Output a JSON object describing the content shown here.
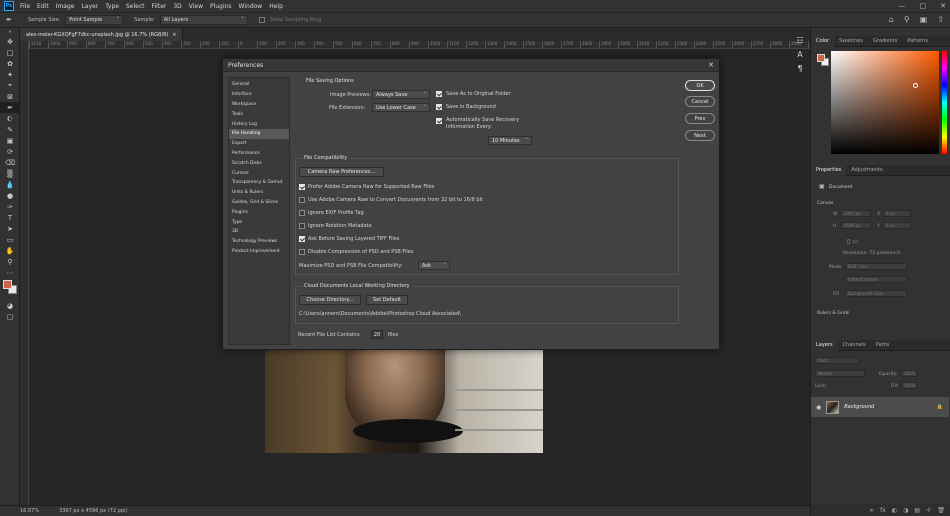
{
  "app": {
    "logo": "Ps",
    "menus": [
      "File",
      "Edit",
      "Image",
      "Layer",
      "Type",
      "Select",
      "Filter",
      "3D",
      "View",
      "Plugins",
      "Window",
      "Help"
    ]
  },
  "options_bar": {
    "sample_size_label": "Sample Size:",
    "sample_size_value": "Point Sample",
    "sample_label": "Sample:",
    "sample_value": "All Layers",
    "sampling_ring_label": "Show Sampling Ring"
  },
  "document": {
    "tab_label": "alex-meier-KGXQFgF7dkc-unsplash.jpg @ 16.7% (RGB/8)",
    "ruler_ticks": [
      "1100",
      "1000",
      "900",
      "800",
      "700",
      "600",
      "500",
      "400",
      "300",
      "200",
      "100",
      "0",
      "100",
      "200",
      "300",
      "400",
      "500",
      "600",
      "700",
      "800",
      "900",
      "1000",
      "1100",
      "1200",
      "1300",
      "1400",
      "1500",
      "1600",
      "1700",
      "1800",
      "1900",
      "2000",
      "2100",
      "2200",
      "2300",
      "2400",
      "2500",
      "2600",
      "2700",
      "2800",
      "2900",
      "3000",
      "3100",
      "3200",
      "3300",
      "3400",
      "3500",
      "3600",
      "3700",
      "3800",
      "3900"
    ]
  },
  "status_bar": {
    "zoom": "16.67%",
    "doc_info": "3367 px x 4596 px (72 ppi)"
  },
  "color_panel": {
    "tabs": [
      "Color",
      "Swatches",
      "Gradients",
      "Patterns"
    ],
    "fg_color": "#c8664a",
    "bg_color": "#f3f3f3"
  },
  "properties_panel": {
    "tabs": [
      "Properties",
      "Adjustments"
    ],
    "doc_label": "Document",
    "canvas_section": "Canvas",
    "w_label": "W",
    "w_value": "3367 px",
    "h_label": "H",
    "h_value": "4596 px",
    "x_label": "X",
    "x_value": "0 px",
    "y_label": "Y",
    "y_value": "0 px",
    "resolution": "Resolution: 72 pixels/inch",
    "mode_label": "Mode",
    "mode_value": "RGB Color",
    "depth_value": "8 Bits/Channel",
    "fill_label": "Fill",
    "fill_value": "Background Color",
    "rulers_section": "Rulers & Grids"
  },
  "layers_panel": {
    "tabs": [
      "Layers",
      "Channels",
      "Paths"
    ],
    "kind_label": "Kind",
    "blend_mode": "Normal",
    "opacity_label": "Opacity:",
    "opacity_value": "100%",
    "lock_label": "Lock:",
    "fill_label": "Fill:",
    "fill_value": "100%",
    "layer_name": "Background"
  },
  "dialog": {
    "title": "Preferences",
    "categories": [
      "General",
      "Interface",
      "Workspace",
      "Tools",
      "History Log",
      "File Handling",
      "Export",
      "Performance",
      "Scratch Disks",
      "Cursors",
      "Transparency & Gamut",
      "Units & Rulers",
      "Guides, Grid & Slices",
      "Plugins",
      "Type",
      "3D",
      "Technology Previews",
      "Product Improvement"
    ],
    "active_category": "File Handling",
    "file_saving": {
      "title": "File Saving Options",
      "image_previews_label": "Image Previews:",
      "image_previews_value": "Always Save",
      "file_extension_label": "File Extension:",
      "file_extension_value": "Use Lower Case",
      "save_as_original": "Save As to Original Folder",
      "save_in_background": "Save in Background",
      "auto_save_line1": "Automatically Save Recovery",
      "auto_save_line2": "Information Every:",
      "auto_save_interval": "10 Minutes"
    },
    "compat": {
      "title": "File Compatibility",
      "camera_raw_button": "Camera Raw Preferences...",
      "prefer_acr": "Prefer Adobe Camera Raw for Supported Raw Files",
      "use_acr_convert": "Use Adobe Camera Raw to Convert Documents from 32 bit to 16/8 bit",
      "ignore_exif": "Ignore EXIF Profile Tag",
      "ignore_rotation": "Ignore Rotation Metadata",
      "ask_tiff": "Ask Before Saving Layered TIFF Files",
      "disable_compression": "Disable Compression of PSD and PSB Files",
      "maximize_label": "Maximize PSD and PSB File Compatibility:",
      "maximize_value": "Ask"
    },
    "cloud": {
      "title": "Cloud Documents Local Working Directory",
      "choose_button": "Choose Directory...",
      "default_button": "Set Default",
      "path": "C:\\Users\\annem\\Documents\\Adobe\\Photoshop Cloud Associated\\"
    },
    "recent_label": "Recent File List Contains:",
    "recent_value": "20",
    "recent_unit": "files",
    "buttons": {
      "ok": "OK",
      "cancel": "Cancel",
      "prev": "Prev",
      "next": "Next"
    }
  }
}
